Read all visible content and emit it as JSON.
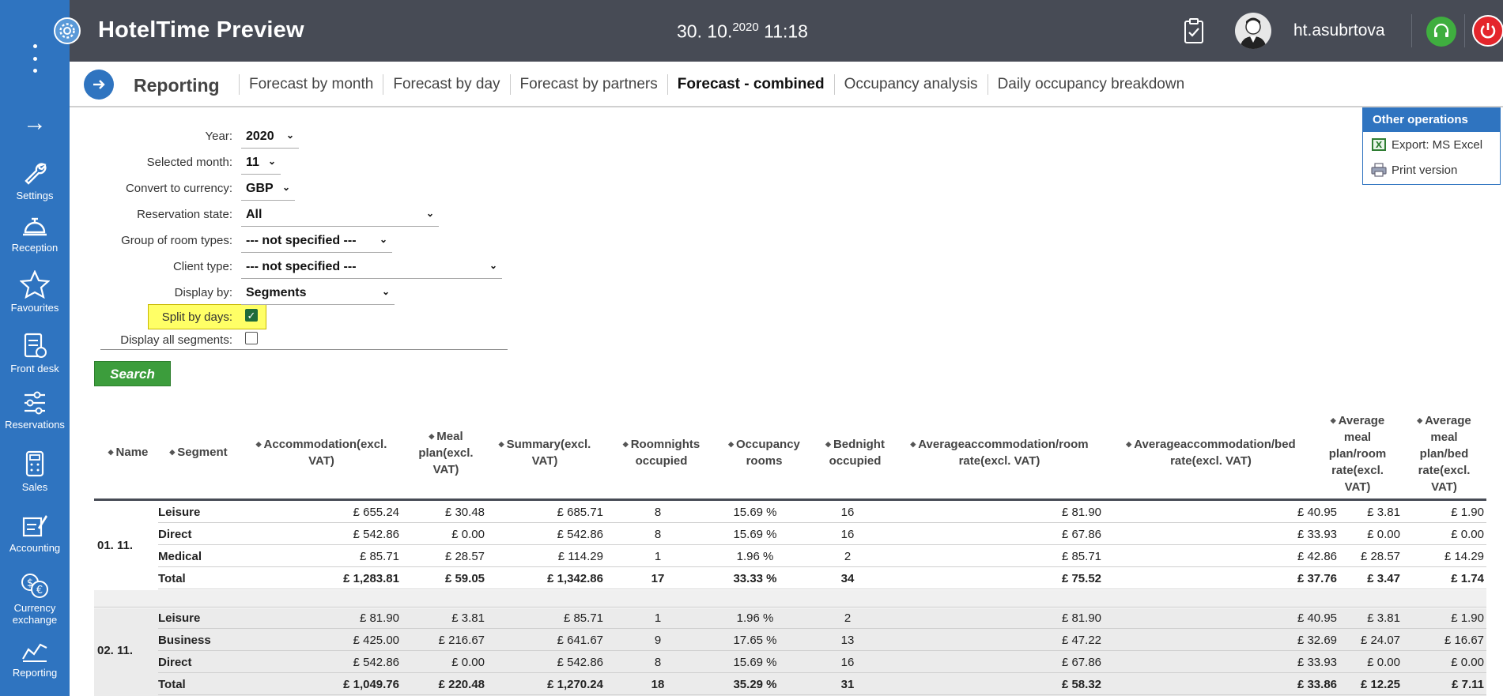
{
  "app": {
    "title": "HotelTime Preview",
    "date_main": "30. 10.",
    "date_year": "2020",
    "time": "11:18",
    "username": "ht.asubrtova"
  },
  "sidebar": {
    "items": [
      {
        "label": "Settings",
        "icon": "wrench-icon"
      },
      {
        "label": "Reception",
        "icon": "bell-icon"
      },
      {
        "label": "Favourites",
        "icon": "star-icon"
      },
      {
        "label": "Front desk",
        "icon": "clipboard-icon"
      },
      {
        "label": "Reservations",
        "icon": "sliders-icon"
      },
      {
        "label": "Sales",
        "icon": "calculator-icon"
      },
      {
        "label": "Accounting",
        "icon": "accounting-icon"
      },
      {
        "label": "Currency exchange",
        "icon": "currency-icon"
      },
      {
        "label": "Reporting",
        "icon": "chart-icon"
      }
    ]
  },
  "nav": {
    "section": "Reporting",
    "tabs": [
      {
        "label": "Forecast by month",
        "active": false
      },
      {
        "label": "Forecast by day",
        "active": false
      },
      {
        "label": "Forecast by partners",
        "active": false
      },
      {
        "label": "Forecast - combined",
        "active": true
      },
      {
        "label": "Occupancy analysis",
        "active": false
      },
      {
        "label": "Daily occupancy breakdown",
        "active": false
      }
    ]
  },
  "filters": {
    "year": {
      "label": "Year:",
      "value": "2020"
    },
    "month": {
      "label": "Selected month:",
      "value": "11"
    },
    "currency": {
      "label": "Convert to currency:",
      "value": "GBP"
    },
    "reservation_state": {
      "label": "Reservation state:",
      "value": "All"
    },
    "room_group": {
      "label": "Group of room types:",
      "value": "--- not specified ---"
    },
    "client_type": {
      "label": "Client type:",
      "value": "--- not specified ---"
    },
    "display_by": {
      "label": "Display by:",
      "value": "Segments"
    },
    "split_by_days": {
      "label": "Split by days:",
      "checked": true
    },
    "display_all_segments": {
      "label": "Display all segments:",
      "checked": false
    },
    "search_label": "Search"
  },
  "operations": {
    "title": "Other operations",
    "items": [
      {
        "label": "Export: MS Excel",
        "icon": "excel-icon"
      },
      {
        "label": "Print version",
        "icon": "printer-icon"
      }
    ]
  },
  "table": {
    "columns": [
      "Name",
      "Segment",
      "Accommodation(excl. VAT)",
      "Meal plan(excl. VAT)",
      "Summary(excl. VAT)",
      "Roomnights occupied",
      "Occupancy rooms",
      "Bednight occupied",
      "Averageaccommodation/room rate(excl. VAT)",
      "Averageaccommodation/bed rate(excl. VAT)",
      "Average meal plan/room rate(excl. VAT)",
      "Average meal plan/bed rate(excl. VAT)"
    ],
    "groups": [
      {
        "name": "01. 11.",
        "rows": [
          [
            "Leisure",
            "£ 655.24",
            "£ 30.48",
            "£ 685.71",
            "8",
            "15.69 %",
            "16",
            "£ 81.90",
            "£ 40.95",
            "£ 3.81",
            "£ 1.90"
          ],
          [
            "Direct",
            "£ 542.86",
            "£ 0.00",
            "£ 542.86",
            "8",
            "15.69 %",
            "16",
            "£ 67.86",
            "£ 33.93",
            "£ 0.00",
            "£ 0.00"
          ],
          [
            "Medical",
            "£ 85.71",
            "£ 28.57",
            "£ 114.29",
            "1",
            "1.96 %",
            "2",
            "£ 85.71",
            "£ 42.86",
            "£ 28.57",
            "£ 14.29"
          ],
          [
            "Total",
            "£ 1,283.81",
            "£ 59.05",
            "£ 1,342.86",
            "17",
            "33.33 %",
            "34",
            "£ 75.52",
            "£ 37.76",
            "£ 3.47",
            "£ 1.74"
          ]
        ]
      },
      {
        "name": "02. 11.",
        "rows": [
          [
            "Leisure",
            "£ 81.90",
            "£ 3.81",
            "£ 85.71",
            "1",
            "1.96 %",
            "2",
            "£ 81.90",
            "£ 40.95",
            "£ 3.81",
            "£ 1.90"
          ],
          [
            "Business",
            "£ 425.00",
            "£ 216.67",
            "£ 641.67",
            "9",
            "17.65 %",
            "13",
            "£ 47.22",
            "£ 32.69",
            "£ 24.07",
            "£ 16.67"
          ],
          [
            "Direct",
            "£ 542.86",
            "£ 0.00",
            "£ 542.86",
            "8",
            "15.69 %",
            "16",
            "£ 67.86",
            "£ 33.93",
            "£ 0.00",
            "£ 0.00"
          ],
          [
            "Total",
            "£ 1,049.76",
            "£ 220.48",
            "£ 1,270.24",
            "18",
            "35.29 %",
            "31",
            "£ 58.32",
            "£ 33.86",
            "£ 12.25",
            "£ 7.11"
          ]
        ]
      }
    ]
  },
  "colors": {
    "sidebar": "#2f74c0",
    "topbar": "#474b55",
    "accent_green": "#3c9d3c",
    "highlight": "#ffff66",
    "power": "#e4252b"
  }
}
